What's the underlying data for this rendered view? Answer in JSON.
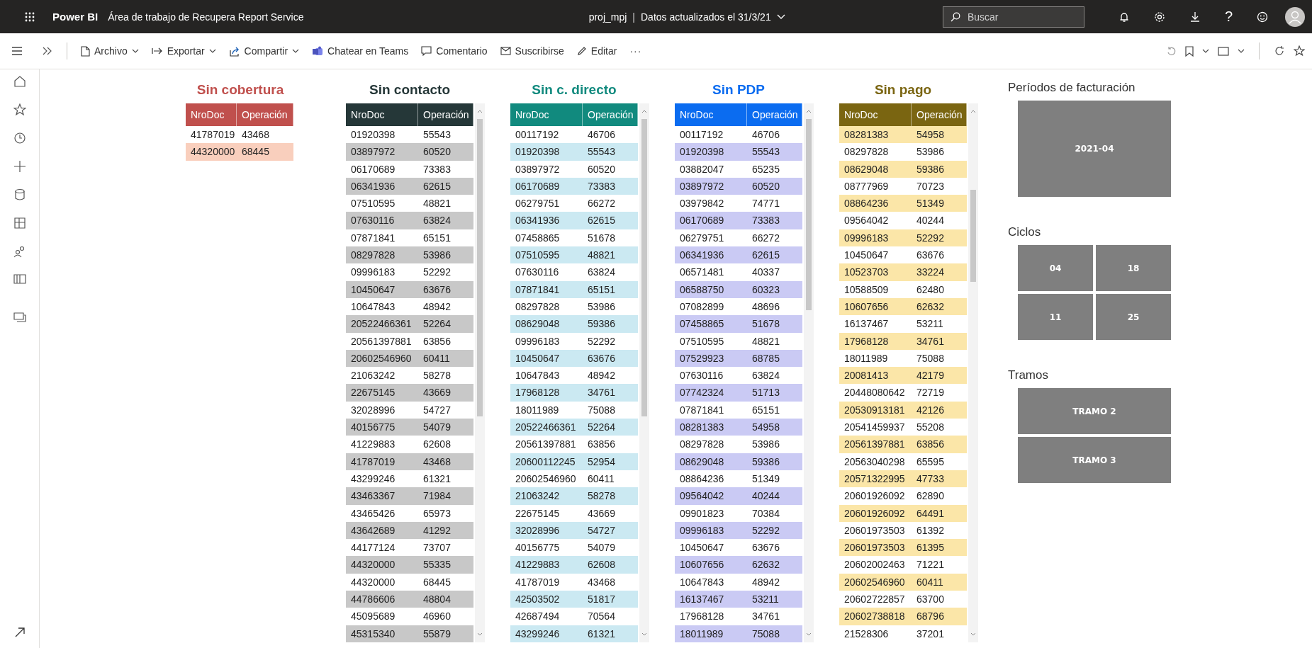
{
  "top_bar": {
    "app_name": "Power BI",
    "workspace": "Área de trabajo de Recupera Report Service",
    "report": "proj_mpj",
    "separator": "|",
    "updated": "Datos actualizados el 31/3/21",
    "search": {
      "placeholder": "Buscar"
    },
    "help": "?"
  },
  "toolbar": {
    "items": [
      {
        "label": "Archivo",
        "dropdown": true
      },
      {
        "label": "Exportar",
        "dropdown": true
      },
      {
        "label": "Compartir",
        "dropdown": true
      },
      {
        "label": "Chatear en Teams",
        "dropdown": false
      },
      {
        "label": "Comentario",
        "dropdown": false
      },
      {
        "label": "Suscribirse",
        "dropdown": false
      },
      {
        "label": "Editar",
        "dropdown": false
      }
    ],
    "more": "···"
  },
  "tables": [
    {
      "title": "Sin cobertura",
      "color": "#c0504d",
      "scrollable": false,
      "first_striped": false,
      "columns": [
        "NroDoc",
        "Operación"
      ],
      "rows": [
        [
          "41787019",
          "43468"
        ],
        [
          "44320000",
          "68445"
        ]
      ]
    },
    {
      "title": "Sin contacto",
      "color": "#253738",
      "scrollable": true,
      "first_striped": false,
      "columns": [
        "NroDoc",
        "Operación"
      ],
      "rows": [
        [
          "01920398",
          "55543"
        ],
        [
          "03897972",
          "60520"
        ],
        [
          "06170689",
          "73383"
        ],
        [
          "06341936",
          "62615"
        ],
        [
          "07510595",
          "48821"
        ],
        [
          "07630116",
          "63824"
        ],
        [
          "07871841",
          "65151"
        ],
        [
          "08297828",
          "53986"
        ],
        [
          "09996183",
          "52292"
        ],
        [
          "10450647",
          "63676"
        ],
        [
          "10647843",
          "48942"
        ],
        [
          "20522466361",
          "52264"
        ],
        [
          "20561397881",
          "63856"
        ],
        [
          "20602546960",
          "60411"
        ],
        [
          "21063242",
          "58278"
        ],
        [
          "22675145",
          "43669"
        ],
        [
          "32028996",
          "54727"
        ],
        [
          "40156775",
          "54079"
        ],
        [
          "41229883",
          "62608"
        ],
        [
          "41787019",
          "43468"
        ],
        [
          "43299246",
          "61321"
        ],
        [
          "43463367",
          "71984"
        ],
        [
          "43465426",
          "65973"
        ],
        [
          "43642689",
          "41292"
        ],
        [
          "44177124",
          "73707"
        ],
        [
          "44320000",
          "55335"
        ],
        [
          "44320000",
          "68445"
        ],
        [
          "44786606",
          "48804"
        ],
        [
          "45095689",
          "46960"
        ],
        [
          "45315340",
          "55879"
        ]
      ]
    },
    {
      "title": "Sin c. directo",
      "color": "#118a7e",
      "scrollable": true,
      "first_striped": false,
      "columns": [
        "NroDoc",
        "Operación"
      ],
      "rows": [
        [
          "00117192",
          "46706"
        ],
        [
          "01920398",
          "55543"
        ],
        [
          "03897972",
          "60520"
        ],
        [
          "06170689",
          "73383"
        ],
        [
          "06279751",
          "66272"
        ],
        [
          "06341936",
          "62615"
        ],
        [
          "07458865",
          "51678"
        ],
        [
          "07510595",
          "48821"
        ],
        [
          "07630116",
          "63824"
        ],
        [
          "07871841",
          "65151"
        ],
        [
          "08297828",
          "53986"
        ],
        [
          "08629048",
          "59386"
        ],
        [
          "09996183",
          "52292"
        ],
        [
          "10450647",
          "63676"
        ],
        [
          "10647843",
          "48942"
        ],
        [
          "17968128",
          "34761"
        ],
        [
          "18011989",
          "75088"
        ],
        [
          "20522466361",
          "52264"
        ],
        [
          "20561397881",
          "63856"
        ],
        [
          "20600112245",
          "52954"
        ],
        [
          "20602546960",
          "60411"
        ],
        [
          "21063242",
          "58278"
        ],
        [
          "22675145",
          "43669"
        ],
        [
          "32028996",
          "54727"
        ],
        [
          "40156775",
          "54079"
        ],
        [
          "41229883",
          "62608"
        ],
        [
          "41787019",
          "43468"
        ],
        [
          "42503502",
          "51817"
        ],
        [
          "42687494",
          "70564"
        ],
        [
          "43299246",
          "61321"
        ]
      ]
    },
    {
      "title": "Sin PDP",
      "color": "#0b6cf0",
      "scrollable": true,
      "first_striped": false,
      "columns": [
        "NroDoc",
        "Operación"
      ],
      "rows": [
        [
          "00117192",
          "46706"
        ],
        [
          "01920398",
          "55543"
        ],
        [
          "03882047",
          "65235"
        ],
        [
          "03897972",
          "60520"
        ],
        [
          "03979842",
          "74771"
        ],
        [
          "06170689",
          "73383"
        ],
        [
          "06279751",
          "66272"
        ],
        [
          "06341936",
          "62615"
        ],
        [
          "06571481",
          "40337"
        ],
        [
          "06588750",
          "60323"
        ],
        [
          "07082899",
          "48696"
        ],
        [
          "07458865",
          "51678"
        ],
        [
          "07510595",
          "48821"
        ],
        [
          "07529923",
          "68785"
        ],
        [
          "07630116",
          "63824"
        ],
        [
          "07742324",
          "51713"
        ],
        [
          "07871841",
          "65151"
        ],
        [
          "08281383",
          "54958"
        ],
        [
          "08297828",
          "53986"
        ],
        [
          "08629048",
          "59386"
        ],
        [
          "08864236",
          "51349"
        ],
        [
          "09564042",
          "40244"
        ],
        [
          "09901823",
          "70384"
        ],
        [
          "09996183",
          "52292"
        ],
        [
          "10450647",
          "63676"
        ],
        [
          "10607656",
          "62632"
        ],
        [
          "10647843",
          "48942"
        ],
        [
          "16137467",
          "53211"
        ],
        [
          "17968128",
          "34761"
        ],
        [
          "18011989",
          "75088"
        ]
      ]
    },
    {
      "title": "Sin pago",
      "color": "#7a6511",
      "scrollable": true,
      "first_striped": true,
      "columns": [
        "NroDoc",
        "Operación"
      ],
      "rows": [
        [
          "08281383",
          "54958"
        ],
        [
          "08297828",
          "53986"
        ],
        [
          "08629048",
          "59386"
        ],
        [
          "08777969",
          "70723"
        ],
        [
          "08864236",
          "51349"
        ],
        [
          "09564042",
          "40244"
        ],
        [
          "09996183",
          "52292"
        ],
        [
          "10450647",
          "63676"
        ],
        [
          "10523703",
          "33224"
        ],
        [
          "10588509",
          "62480"
        ],
        [
          "10607656",
          "62632"
        ],
        [
          "16137467",
          "53211"
        ],
        [
          "17968128",
          "34761"
        ],
        [
          "18011989",
          "75088"
        ],
        [
          "20081413",
          "42179"
        ],
        [
          "20448080642",
          "72719"
        ],
        [
          "20530913181",
          "42126"
        ],
        [
          "20541459937",
          "55208"
        ],
        [
          "20561397881",
          "63856"
        ],
        [
          "20563040298",
          "65595"
        ],
        [
          "20571322995",
          "47733"
        ],
        [
          "20601926092",
          "62890"
        ],
        [
          "20601926092",
          "64491"
        ],
        [
          "20601973503",
          "61392"
        ],
        [
          "20601973503",
          "61395"
        ],
        [
          "20602002463",
          "71221"
        ],
        [
          "20602546960",
          "60411"
        ],
        [
          "20602722857",
          "63700"
        ],
        [
          "20602738818",
          "68796"
        ],
        [
          "21528306",
          "37201"
        ]
      ]
    }
  ],
  "slicers": [
    {
      "title": "Períodos de facturación",
      "options": [
        "2021-04"
      ]
    },
    {
      "title": "Ciclos",
      "options": [
        "04",
        "18",
        "11",
        "25"
      ]
    },
    {
      "title": "Tramos",
      "options": [
        "TRAMO 2",
        "TRAMO 3"
      ]
    }
  ]
}
